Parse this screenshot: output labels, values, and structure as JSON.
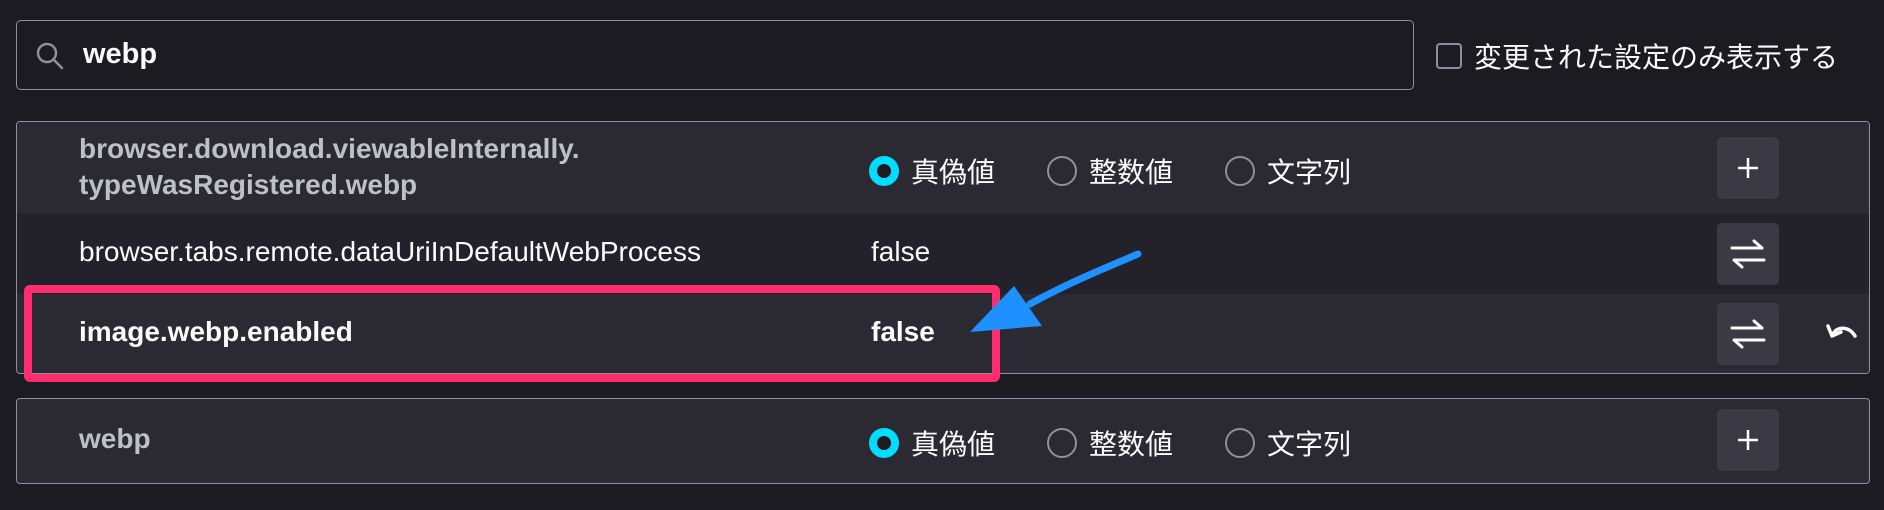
{
  "search": {
    "value": "webp",
    "icon": "search-icon"
  },
  "filter": {
    "label": "変更された設定のみ表示する",
    "checked": false
  },
  "type_options": [
    "真偽値",
    "整数値",
    "文字列"
  ],
  "prefs": [
    {
      "name_line1": "browser.download.viewableInternally.",
      "name_line2": "typeWasRegistered.webp",
      "status": "new",
      "selected_type": "真偽値",
      "action": "add"
    },
    {
      "name": "browser.tabs.remote.dataUriInDefaultWebProcess",
      "value": "false",
      "status": "default",
      "action": "toggle"
    },
    {
      "name": "image.webp.enabled",
      "value": "false",
      "status": "modified",
      "action": "toggle",
      "reset": true
    }
  ],
  "new_pref": {
    "name": "webp",
    "selected_type": "真偽値",
    "action": "add"
  },
  "annotation": {
    "highlight_color": "#ff2d6d",
    "arrow_color": "#1e90ff"
  },
  "colors": {
    "background": "#1c1b22",
    "row": "#2b2a33",
    "row_alt": "#23222b",
    "radio_accent": "#00ddff"
  }
}
